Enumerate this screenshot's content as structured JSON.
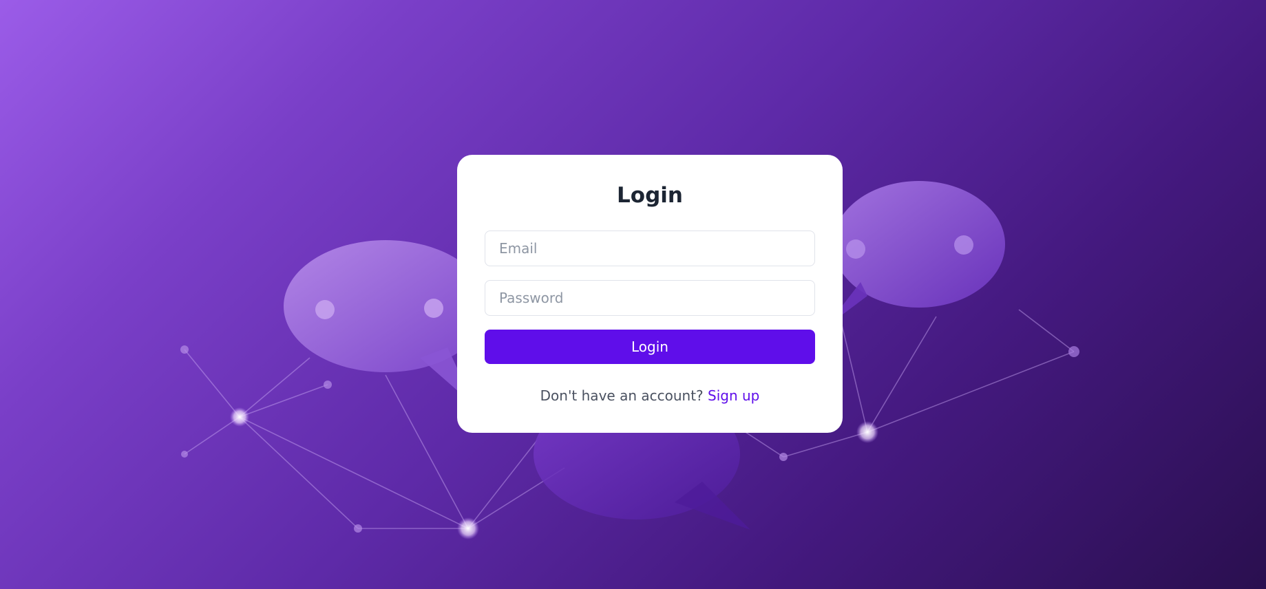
{
  "login": {
    "title": "Login",
    "email_placeholder": "Email",
    "password_placeholder": "Password",
    "submit_label": "Login",
    "signup_prompt": "Don't have an account?",
    "signup_link": "Sign up"
  },
  "colors": {
    "accent": "#5f0eea",
    "background_start": "#9b5ce8",
    "background_end": "#2a0f4f",
    "card": "#ffffff"
  },
  "background": {
    "illustration": "chat-bubbles-network"
  }
}
